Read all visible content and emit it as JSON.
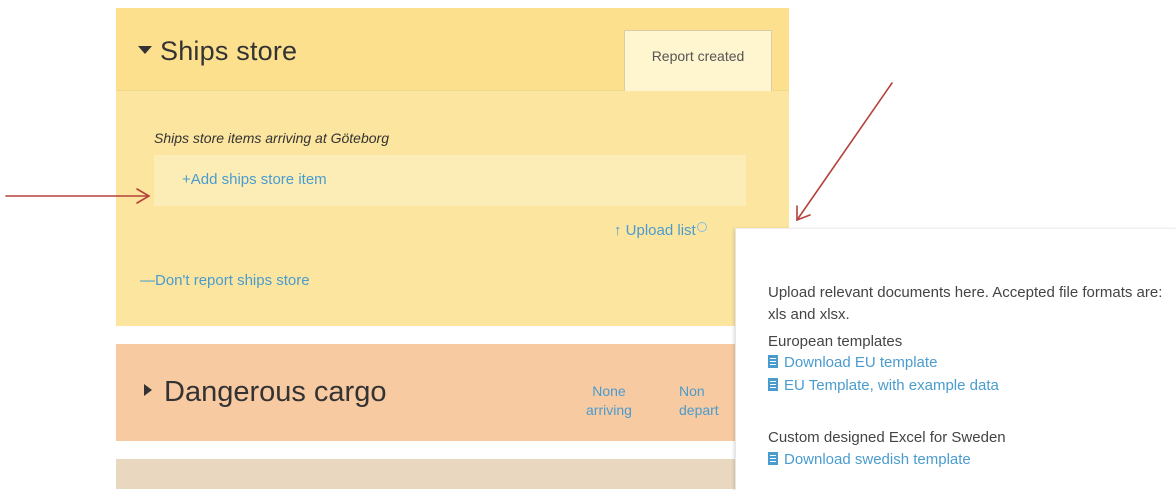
{
  "ships_store": {
    "title": "Ships store",
    "status_tab": "Report created",
    "arriving_label": "Ships store items arriving at Göteborg",
    "add_item": "+Add ships store item",
    "upload_list": "Upload list",
    "dont_report": "—Don't report ships store"
  },
  "dangerous_cargo": {
    "title": "Dangerous cargo",
    "arriving_line1": "None",
    "arriving_line2": "arriving",
    "departing_line1": "Non",
    "departing_line2": "depart"
  },
  "tooltip": {
    "description": "Upload relevant documents here. Accepted file formats are: xls and xlsx.",
    "groups": [
      {
        "label": "European templates",
        "links": [
          "Download EU template",
          "EU Template, with example data"
        ]
      },
      {
        "label": "Custom designed Excel for Sweden",
        "links": [
          "Download swedish template"
        ]
      }
    ]
  },
  "colors": {
    "ships_store_bg": "#fce59e",
    "dangerous_cargo_bg": "#f8caa1",
    "link": "#4a9ccf",
    "annotation_arrow": "#b5413c"
  },
  "icons": [
    "caret-down-icon",
    "caret-right-icon",
    "upload-arrow-icon",
    "info-icon",
    "document-icon"
  ]
}
